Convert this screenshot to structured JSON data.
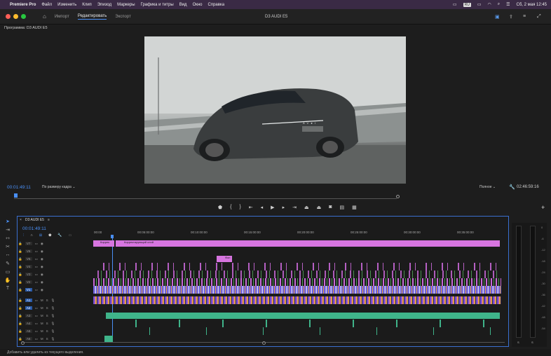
{
  "menubar": {
    "apple": "",
    "app": "Premiere Pro",
    "items": [
      "Файл",
      "Изменить",
      "Клип",
      "Эпизод",
      "Маркеры",
      "Графика и титры",
      "Вид",
      "Окно",
      "Справка"
    ],
    "datetime": "Сб, 2 мая  12:45"
  },
  "titlebar": {
    "tabs": [
      "Импорт",
      "Редактировать",
      "Экспорт"
    ],
    "active_tab": 1,
    "title": "D3 AUDI E5"
  },
  "program": {
    "label": "Программа: D3 AUDI E5",
    "timecode_left": "00:01:49:11",
    "fit": "По размеру кадра",
    "quality": "Полное",
    "timecode_right": "02:46:59:16",
    "video_badge": "A V ● I"
  },
  "sequence": {
    "tab": "D3 AUDI E5",
    "timecode": "00:01:49:11",
    "ruler": [
      "00:00",
      "00:05:00:00",
      "00:10:00:00",
      "00:15:00:00",
      "00:20:00:00",
      "00:25:00:00",
      "00:30:00:00",
      "00:35:00:00"
    ],
    "video_tracks": [
      "V7",
      "V6",
      "V5",
      "V4",
      "V3",
      "V2",
      "V1"
    ],
    "audio_tracks": [
      "A1",
      "A2",
      "A3",
      "A4",
      "A5",
      "A6"
    ],
    "adjustment_clip_1": "Коррек",
    "adjustment_clip_2": "Корректирующий слой",
    "small_clip": "Фон"
  },
  "meters": {
    "scale": [
      "0",
      "-6",
      "-12",
      "-18",
      "-24",
      "-30",
      "-36",
      "-42",
      "-48",
      "-54"
    ],
    "channels": [
      "S",
      "S"
    ]
  },
  "status": "Добавить или удалить из текущего выделения.",
  "colors": {
    "accent": "#4a8ff5",
    "adjustment": "#d775e0",
    "video_clip": "#6f5fd8",
    "audio_clip": "#3fb48a",
    "orange_clip": "#e0a040"
  }
}
